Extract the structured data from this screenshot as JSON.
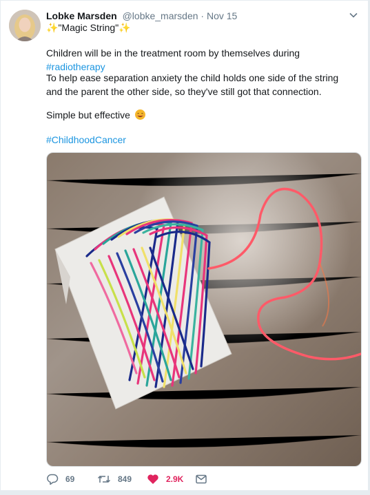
{
  "tweet": {
    "author_name": "Lobke Marsden",
    "author_handle": "@lobke_marsden",
    "separator": "·",
    "timestamp": "Nov 15",
    "subtitle": "\"Magic String\"",
    "paragraph1_text": "Children will be in the treatment room by themselves during ",
    "paragraph1_hashtag": "#radiotherapy",
    "paragraph2": "To help ease separation anxiety the child holds one side of the string and the parent the other side, so they've still got that connection.",
    "paragraph3": "Simple but effective",
    "hashtag2": "#ChildhoodCancer",
    "image_description": "photo of a wooden table with colourful string wound around a white card"
  },
  "actions": {
    "reply_count": "69",
    "retweet_count": "849",
    "like_count": "2.9K"
  },
  "colors": {
    "link": "#1b95e0",
    "muted": "#657786",
    "like": "#e0245e",
    "sparkle": "#ab8ef0"
  },
  "icons": [
    "chevron-down-icon",
    "sparkle-icon",
    "smiling-face-icon",
    "reply-icon",
    "retweet-icon",
    "heart-icon",
    "direct-message-icon"
  ]
}
